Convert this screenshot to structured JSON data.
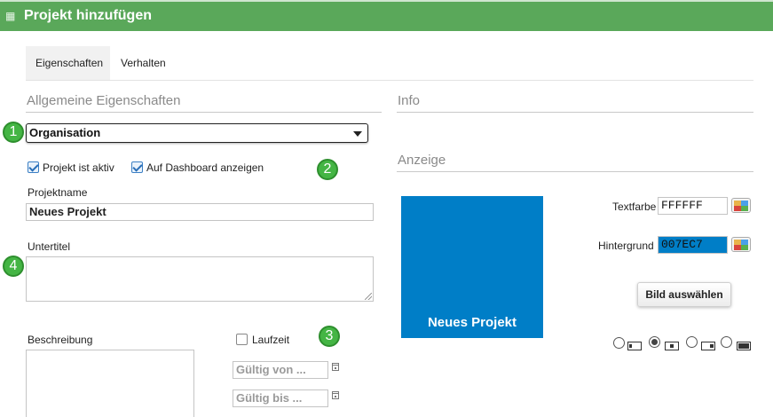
{
  "window": {
    "title": "Projekt hinzufügen"
  },
  "tabs": [
    {
      "label": "Eigenschaften",
      "active": true
    },
    {
      "label": "Verhalten",
      "active": false
    }
  ],
  "sections": {
    "general": "Allgemeine Eigenschaften",
    "info": "Info",
    "display": "Anzeige"
  },
  "badges": [
    "1",
    "2",
    "3",
    "4"
  ],
  "organisation": {
    "selected": "Organisation"
  },
  "checkboxes": {
    "active": {
      "label": "Projekt ist aktiv",
      "checked": true
    },
    "dashboard": {
      "label": "Auf Dashboard anzeigen",
      "checked": true
    },
    "runtime": {
      "label": "Laufzeit",
      "checked": false
    }
  },
  "fields": {
    "projectname": {
      "label": "Projektname",
      "value": "Neues Projekt"
    },
    "subtitle": {
      "label": "Untertitel",
      "value": ""
    },
    "description": {
      "label": "Beschreibung",
      "value": ""
    },
    "valid_from": {
      "placeholder": "Gültig von ..."
    },
    "valid_to": {
      "placeholder": "Gültig bis ..."
    }
  },
  "preview": {
    "text": "Neues Projekt",
    "background": "#007EC7",
    "text_color": "#FFFFFF"
  },
  "colors": {
    "text": {
      "label": "Textfarbe",
      "value": "FFFFFF"
    },
    "background": {
      "label": "Hintergrund",
      "value": "007EC7"
    }
  },
  "image_button": {
    "label": "Bild auswählen"
  },
  "image_layouts": {
    "selected_index": 1,
    "options": [
      "left-small",
      "center",
      "right-small",
      "full"
    ]
  },
  "theme": {
    "accent": "#5aa85a",
    "badge": "#44b544"
  }
}
